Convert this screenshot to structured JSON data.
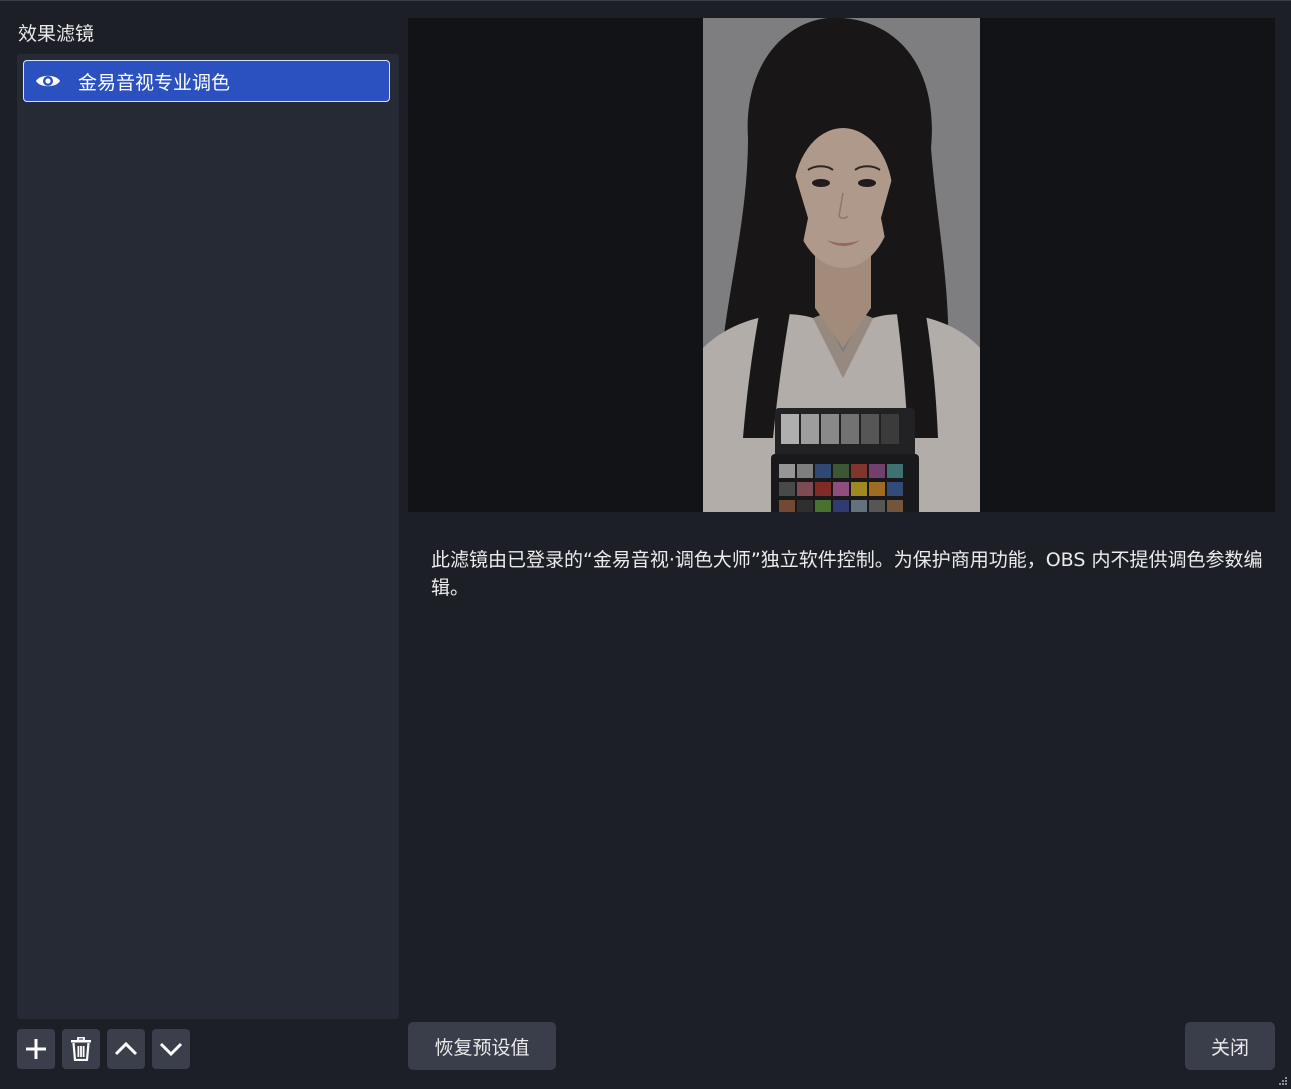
{
  "left_panel": {
    "title": "效果滤镜",
    "filters": [
      {
        "label": "金易音视专业调色",
        "visible": true,
        "selected": true
      }
    ],
    "toolbar": [
      {
        "icon": "plus-icon"
      },
      {
        "icon": "trash-icon"
      },
      {
        "icon": "chevron-up-icon"
      },
      {
        "icon": "chevron-down-icon"
      }
    ]
  },
  "main": {
    "description": "此滤镜由已登录的“金易音视·调色大师”独立软件控制。为保护商用功能，OBS 内不提供调色参数编辑。"
  },
  "buttons": {
    "reset_label": "恢复预设值",
    "close_label": "关闭"
  },
  "colors": {
    "background": "#1d1f26",
    "list_background": "#262a35",
    "selected_item": "#2a51bf",
    "button": "#3a3e4a"
  }
}
